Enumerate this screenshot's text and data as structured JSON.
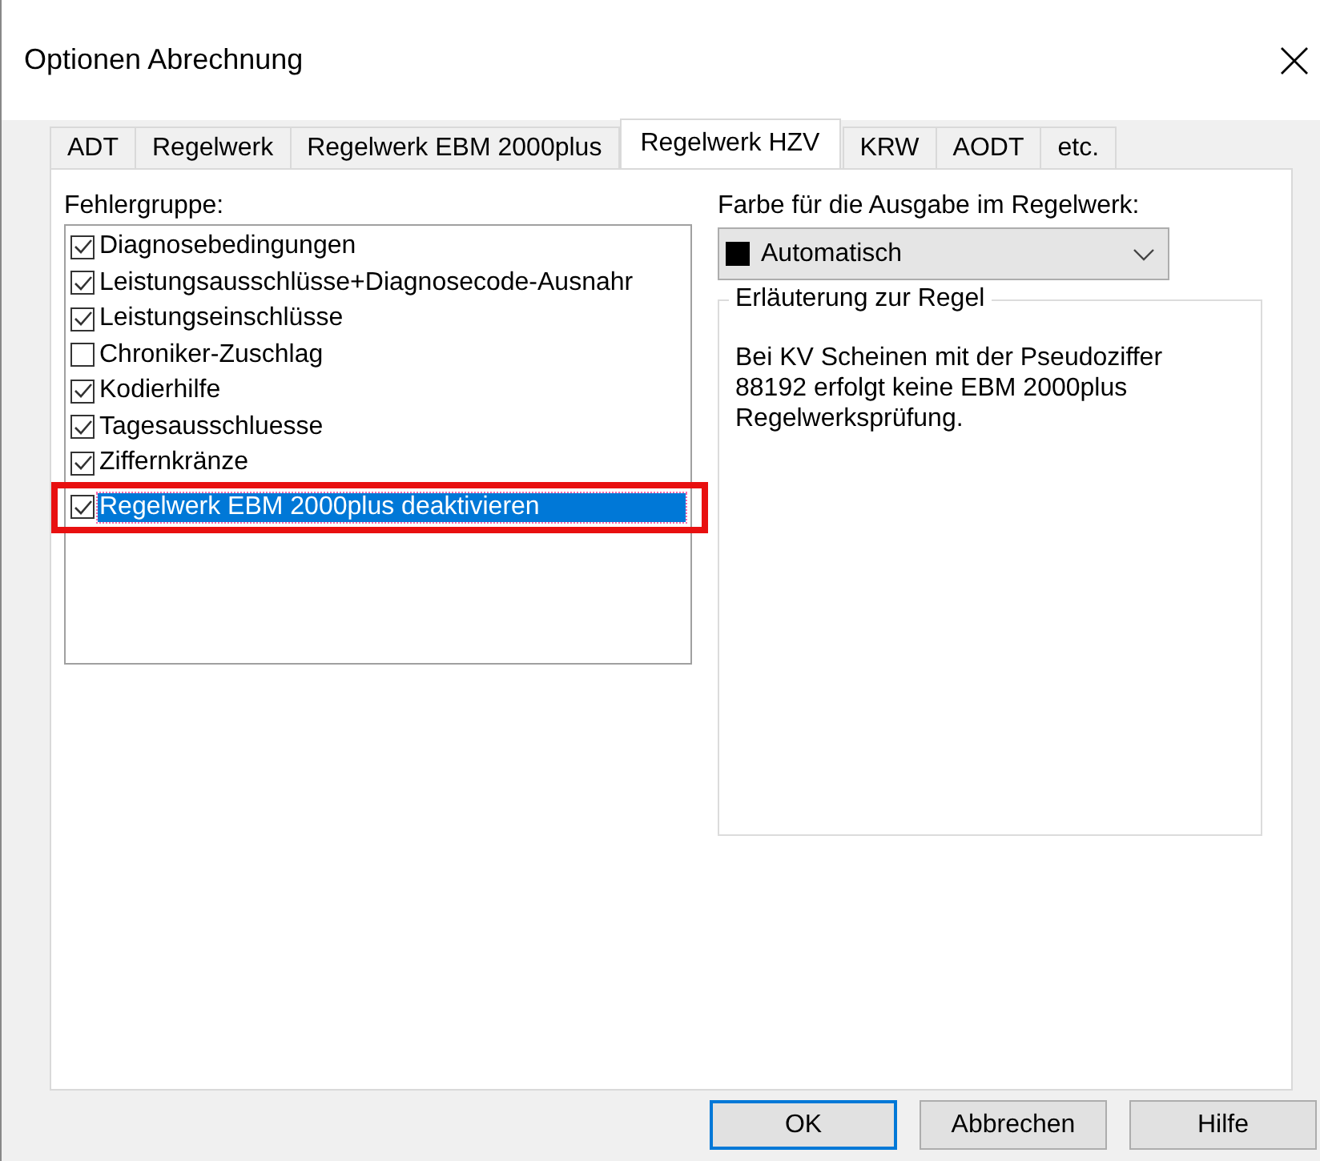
{
  "window": {
    "title": "Optionen Abrechnung"
  },
  "tabs": [
    {
      "label": "ADT",
      "selected": false
    },
    {
      "label": "Regelwerk",
      "selected": false
    },
    {
      "label": "Regelwerk EBM 2000plus",
      "selected": false
    },
    {
      "label": "Regelwerk HZV",
      "selected": true
    },
    {
      "label": "KRW",
      "selected": false
    },
    {
      "label": "AODT",
      "selected": false
    },
    {
      "label": "etc.",
      "selected": false
    }
  ],
  "error_groups": {
    "label": "Fehlergruppe:",
    "items": [
      {
        "label": "Diagnosebedingungen",
        "checked": true,
        "selected": false,
        "highlighted": false
      },
      {
        "label": "Leistungsausschlüsse+Diagnosecode-Ausnahr",
        "checked": true,
        "selected": false,
        "highlighted": false
      },
      {
        "label": "Leistungseinschlüsse",
        "checked": true,
        "selected": false,
        "highlighted": false
      },
      {
        "label": "Chroniker-Zuschlag",
        "checked": false,
        "selected": false,
        "highlighted": false
      },
      {
        "label": "Kodierhilfe",
        "checked": true,
        "selected": false,
        "highlighted": false
      },
      {
        "label": "Tagesausschluesse",
        "checked": true,
        "selected": false,
        "highlighted": false
      },
      {
        "label": "Ziffernkränze",
        "checked": true,
        "selected": false,
        "highlighted": false
      },
      {
        "label": "Regelwerk EBM 2000plus deaktivieren",
        "checked": true,
        "selected": true,
        "highlighted": true
      }
    ]
  },
  "color_output": {
    "label": "Farbe für die Ausgabe im Regelwerk:",
    "value": "Automatisch",
    "color": "#000000"
  },
  "explanation": {
    "title": "Erläuterung zur Regel",
    "text": "Bei KV Scheinen mit der Pseudoziffer 88192 erfolgt keine EBM 2000plus Regelwerksprüfung."
  },
  "buttons": [
    {
      "label": "OK",
      "default": true
    },
    {
      "label": "Abbrechen",
      "default": false
    },
    {
      "label": "Hilfe",
      "default": false
    }
  ]
}
